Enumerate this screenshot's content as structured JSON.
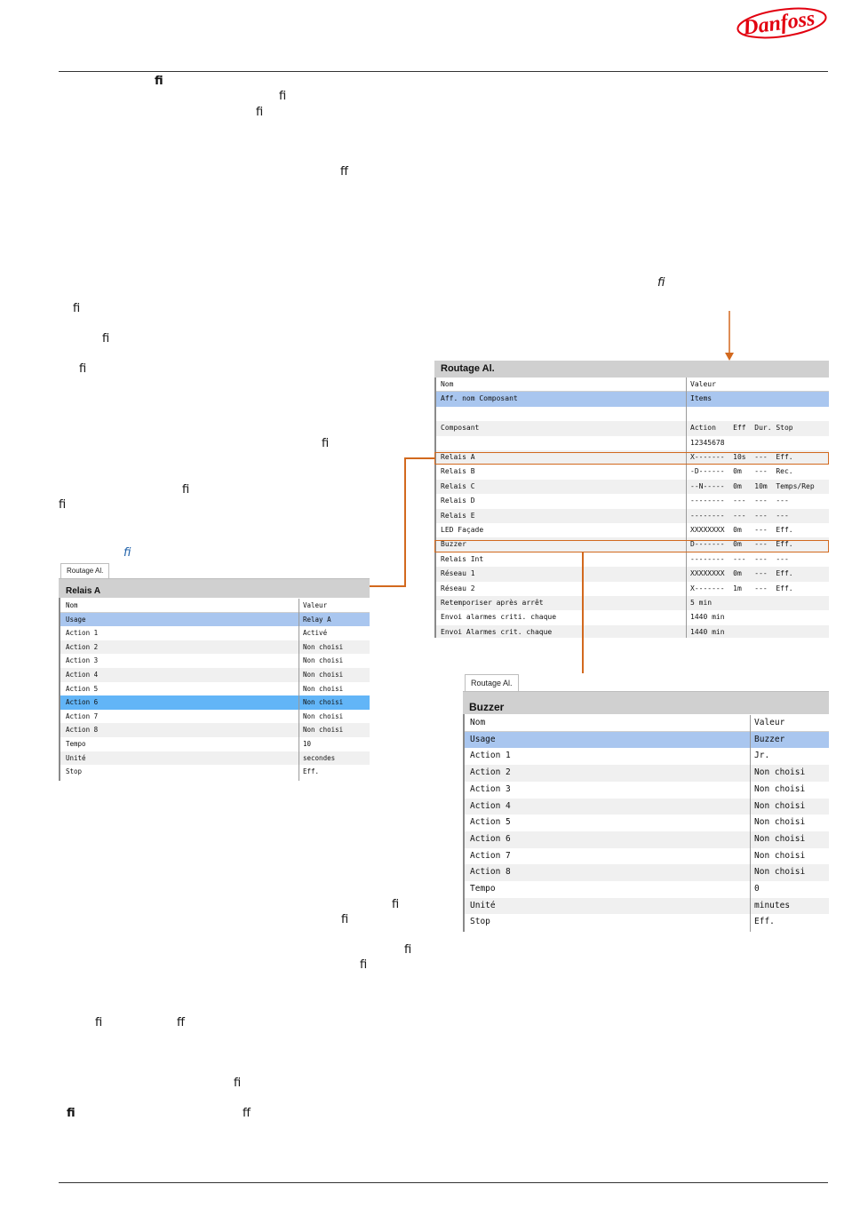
{
  "brand": {
    "logo_text": "Danfoss",
    "color": "#e2000f"
  },
  "ligatures": [
    "ﬁ",
    "ﬁ",
    "ﬁ",
    "ﬀ",
    "ﬁ",
    "ﬁ",
    "ﬁ",
    "ﬁ",
    "ﬁ",
    "ﬁ",
    "ﬁ",
    "ﬁ",
    "ﬁ",
    "ﬁ",
    "ﬁ",
    "ﬁ",
    "ﬁ",
    "ﬀ",
    "ﬁ",
    "ﬁ",
    "ﬀ",
    "ﬀ"
  ],
  "routage": {
    "title": "Routage Al.",
    "headers": {
      "name": "Nom",
      "value": "Valeur"
    },
    "rows": [
      {
        "name": "Aff. nom Composant",
        "value": "Items"
      },
      {
        "name": "",
        "value": ""
      },
      {
        "name": "Composant",
        "value": "Action    Eff  Dur. Stop"
      },
      {
        "name": "",
        "value": "12345678"
      },
      {
        "name": "Relais A",
        "value": "X-------  10s  ---  Eff."
      },
      {
        "name": "Relais B",
        "value": "-D------  0m   ---  Rec."
      },
      {
        "name": "Relais C",
        "value": "--N-----  0m   10m  Temps/Rep"
      },
      {
        "name": "Relais D",
        "value": "--------  ---  ---  ---"
      },
      {
        "name": "Relais E",
        "value": "--------  ---  ---  ---"
      },
      {
        "name": "LED Façade",
        "value": "XXXXXXXX  0m   ---  Eff."
      },
      {
        "name": "Buzzer",
        "value": "D-------  0m   ---  Eff."
      },
      {
        "name": "Relais Int",
        "value": "--------  ---  ---  ---"
      },
      {
        "name": "Réseau 1",
        "value": "XXXXXXXX  0m   ---  Eff."
      },
      {
        "name": "Réseau 2",
        "value": "X-------  1m   ---  Eff."
      },
      {
        "name": "Retemporiser après arrêt",
        "value": "5 min"
      },
      {
        "name": "Envoi alarmes criti. chaque",
        "value": "1440 min"
      },
      {
        "name": "Envoi Alarmes crit. chaque",
        "value": "1440 min"
      }
    ]
  },
  "relais_a": {
    "tab": "Routage Al.",
    "title": "Relais A",
    "headers": {
      "name": "Nom",
      "value": "Valeur"
    },
    "rows": [
      {
        "name": "Usage",
        "value": "Relay A"
      },
      {
        "name": "Action 1",
        "value": "Activé"
      },
      {
        "name": "Action 2",
        "value": "Non choisi"
      },
      {
        "name": "Action 3",
        "value": "Non choisi"
      },
      {
        "name": "Action 4",
        "value": "Non choisi"
      },
      {
        "name": "Action 5",
        "value": "Non choisi"
      },
      {
        "name": "Action 6",
        "value": "Non choisi"
      },
      {
        "name": "Action 7",
        "value": "Non choisi"
      },
      {
        "name": "Action 8",
        "value": "Non choisi"
      },
      {
        "name": "Tempo",
        "value": "10"
      },
      {
        "name": "Unité",
        "value": "secondes"
      },
      {
        "name": "Stop",
        "value": "Eff."
      }
    ]
  },
  "buzzer": {
    "tab": "Routage Al.",
    "title": "Buzzer",
    "headers": {
      "name": "Nom",
      "value": "Valeur"
    },
    "rows": [
      {
        "name": "Usage",
        "value": "Buzzer"
      },
      {
        "name": "Action 1",
        "value": "Jr."
      },
      {
        "name": "Action 2",
        "value": "Non choisi"
      },
      {
        "name": "Action 3",
        "value": "Non choisi"
      },
      {
        "name": "Action 4",
        "value": "Non choisi"
      },
      {
        "name": "Action 5",
        "value": "Non choisi"
      },
      {
        "name": "Action 6",
        "value": "Non choisi"
      },
      {
        "name": "Action 7",
        "value": "Non choisi"
      },
      {
        "name": "Action 8",
        "value": "Non choisi"
      },
      {
        "name": "Tempo",
        "value": "0"
      },
      {
        "name": "Unité",
        "value": "minutes"
      },
      {
        "name": "Stop",
        "value": "Eff."
      }
    ]
  },
  "colors": {
    "highlight": "#a9c6ef",
    "selected": "#62b5f7",
    "callout": "#d2691e",
    "title_bar": "#d0d0d0"
  }
}
